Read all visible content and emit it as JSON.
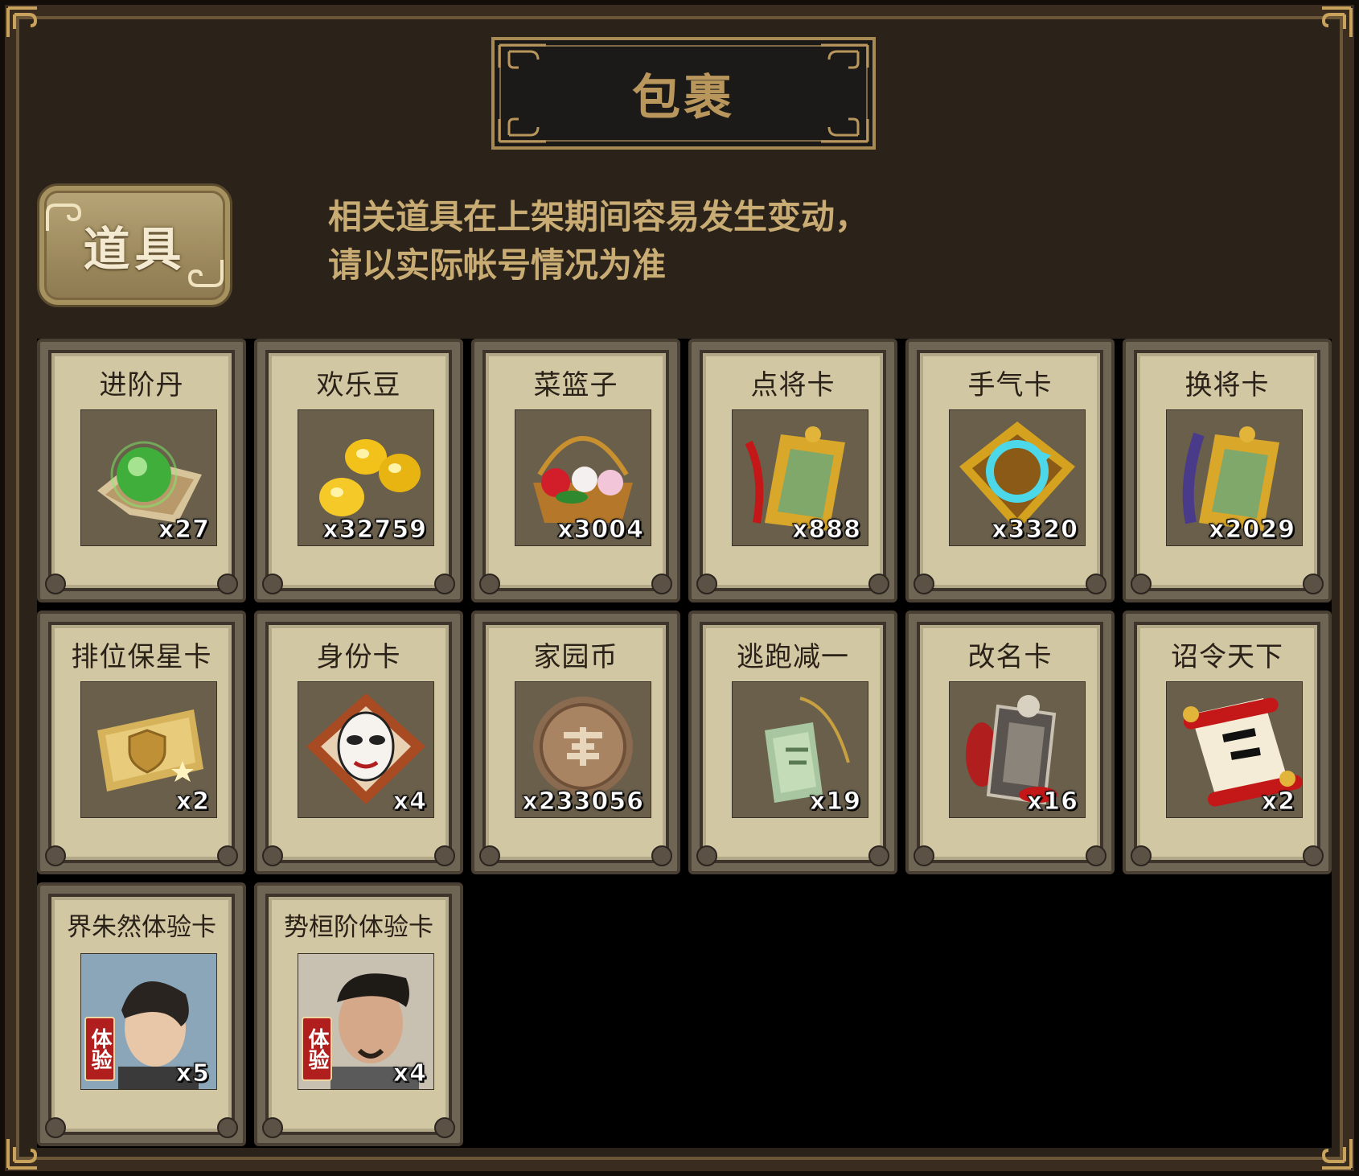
{
  "window": {
    "title": "包裹"
  },
  "tab": {
    "label": "道具"
  },
  "notice": {
    "line1": "相关道具在上架期间容易发生变动，",
    "line2": "请以实际帐号情况为准"
  },
  "items": [
    {
      "name": "进阶丹",
      "qty": "x27",
      "icon": "green-orb-icon"
    },
    {
      "name": "欢乐豆",
      "qty": "x32759",
      "icon": "gold-beans-icon"
    },
    {
      "name": "菜篮子",
      "qty": "x3004",
      "icon": "flower-basket-icon"
    },
    {
      "name": "点将卡",
      "qty": "x888",
      "icon": "jade-token-red-tassel-icon"
    },
    {
      "name": "手气卡",
      "qty": "x3320",
      "icon": "refresh-card-icon"
    },
    {
      "name": "换将卡",
      "qty": "x2029",
      "icon": "jade-token-blue-tassel-icon"
    },
    {
      "name": "排位保星卡",
      "qty": "x2",
      "icon": "gold-shield-ticket-icon"
    },
    {
      "name": "身份卡",
      "qty": "x4",
      "icon": "opera-mask-card-icon"
    },
    {
      "name": "家园币",
      "qty": "x233056",
      "icon": "bronze-coin-icon"
    },
    {
      "name": "逃跑减一",
      "qty": "x19",
      "icon": "jade-pendant-icon"
    },
    {
      "name": "改名卡",
      "qty": "x16",
      "icon": "name-plaque-icon"
    },
    {
      "name": "诏令天下",
      "qty": "x2",
      "icon": "imperial-scroll-icon"
    },
    {
      "name": "界朱然体验卡",
      "qty": "x5",
      "icon": "hero-portrait-icon",
      "badge": "体验"
    },
    {
      "name": "势桓阶体验卡",
      "qty": "x4",
      "icon": "hero-portrait-icon",
      "badge": "体验"
    }
  ],
  "colors": {
    "panel_bg": "#2b2219",
    "gold_text": "#c9ac73",
    "card_bg": "#d2c7a3",
    "icon_bg": "#6a5f4b"
  }
}
